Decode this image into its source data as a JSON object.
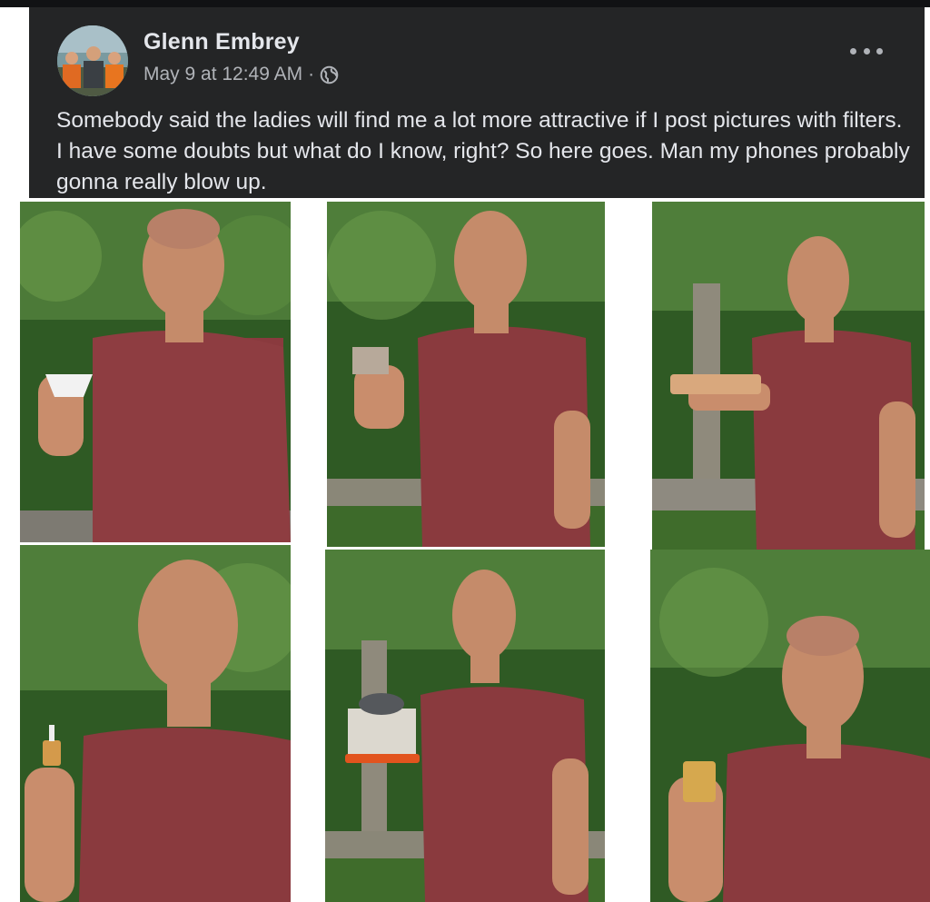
{
  "post": {
    "author": "Glenn Embrey",
    "date": "May 9 at 12:49 AM",
    "separator": "·",
    "privacy_icon": "globe-icon",
    "more_icon": "more-options-icon",
    "text": "Somebody said the ladies will find me a lot more attractive if I post pictures with filters. I have some doubts but what do I know, right? So here goes. Man my phones probably gonna really blow up."
  },
  "photos": [
    {
      "object": "coffee filter"
    },
    {
      "object": "small cylindrical filter"
    },
    {
      "object": "round air filter"
    },
    {
      "object": "inline fuel filter"
    },
    {
      "object": "pleated air filter"
    },
    {
      "object": "oil filter cartridge"
    }
  ],
  "colors": {
    "card_bg": "#242526",
    "name_text": "#e4e6eb",
    "meta_text": "#b0b3b8",
    "shirt": "#8a3a3e",
    "foliage": "#2f5a24"
  }
}
